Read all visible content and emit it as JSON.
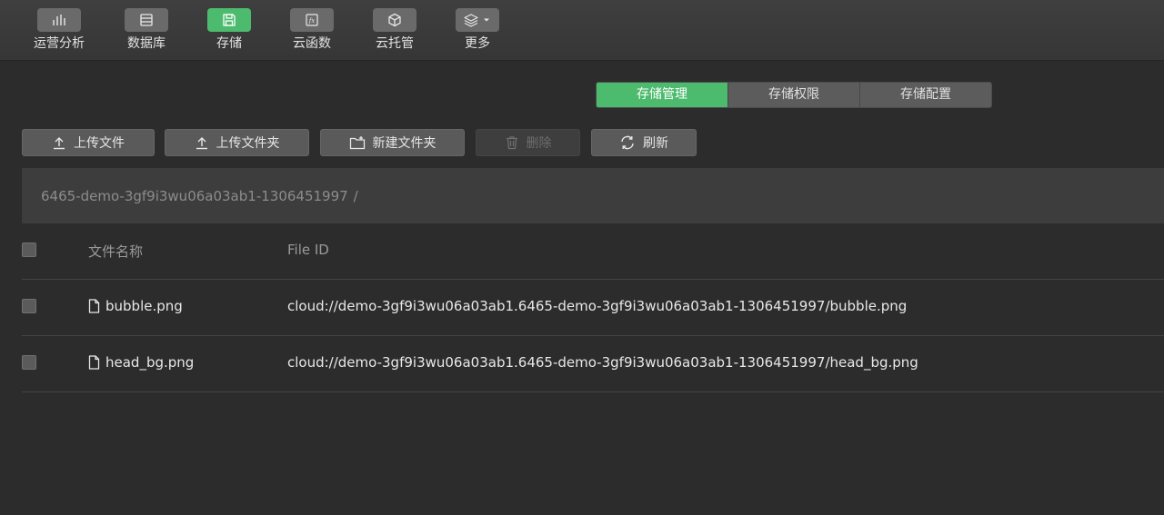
{
  "toolbar": {
    "items": [
      {
        "label": "运营分析",
        "icon": "bar-chart-icon"
      },
      {
        "label": "数据库",
        "icon": "database-icon"
      },
      {
        "label": "存储",
        "icon": "save-disk-icon"
      },
      {
        "label": "云函数",
        "icon": "function-icon"
      },
      {
        "label": "云托管",
        "icon": "cube-icon"
      },
      {
        "label": "更多",
        "icon": "layers-dropdown-icon"
      }
    ],
    "active_index": 2
  },
  "tabs": [
    {
      "label": "存储管理",
      "active": true
    },
    {
      "label": "存储权限",
      "active": false
    },
    {
      "label": "存储配置",
      "active": false
    }
  ],
  "actions": {
    "upload_file": "上传文件",
    "upload_folder": "上传文件夹",
    "new_folder": "新建文件夹",
    "delete": "删除",
    "refresh": "刷新"
  },
  "path": {
    "bucket": "6465-demo-3gf9i3wu06a03ab1-1306451997",
    "separator": "/"
  },
  "table": {
    "headers": {
      "name": "文件名称",
      "file_id": "File ID"
    },
    "rows": [
      {
        "name": "bubble.png",
        "file_id": "cloud://demo-3gf9i3wu06a03ab1.6465-demo-3gf9i3wu06a03ab1-1306451997/bubble.png"
      },
      {
        "name": "head_bg.png",
        "file_id": "cloud://demo-3gf9i3wu06a03ab1.6465-demo-3gf9i3wu06a03ab1-1306451997/head_bg.png"
      }
    ]
  },
  "colors": {
    "accent": "#4cbb6e",
    "background": "#2c2c2c"
  }
}
